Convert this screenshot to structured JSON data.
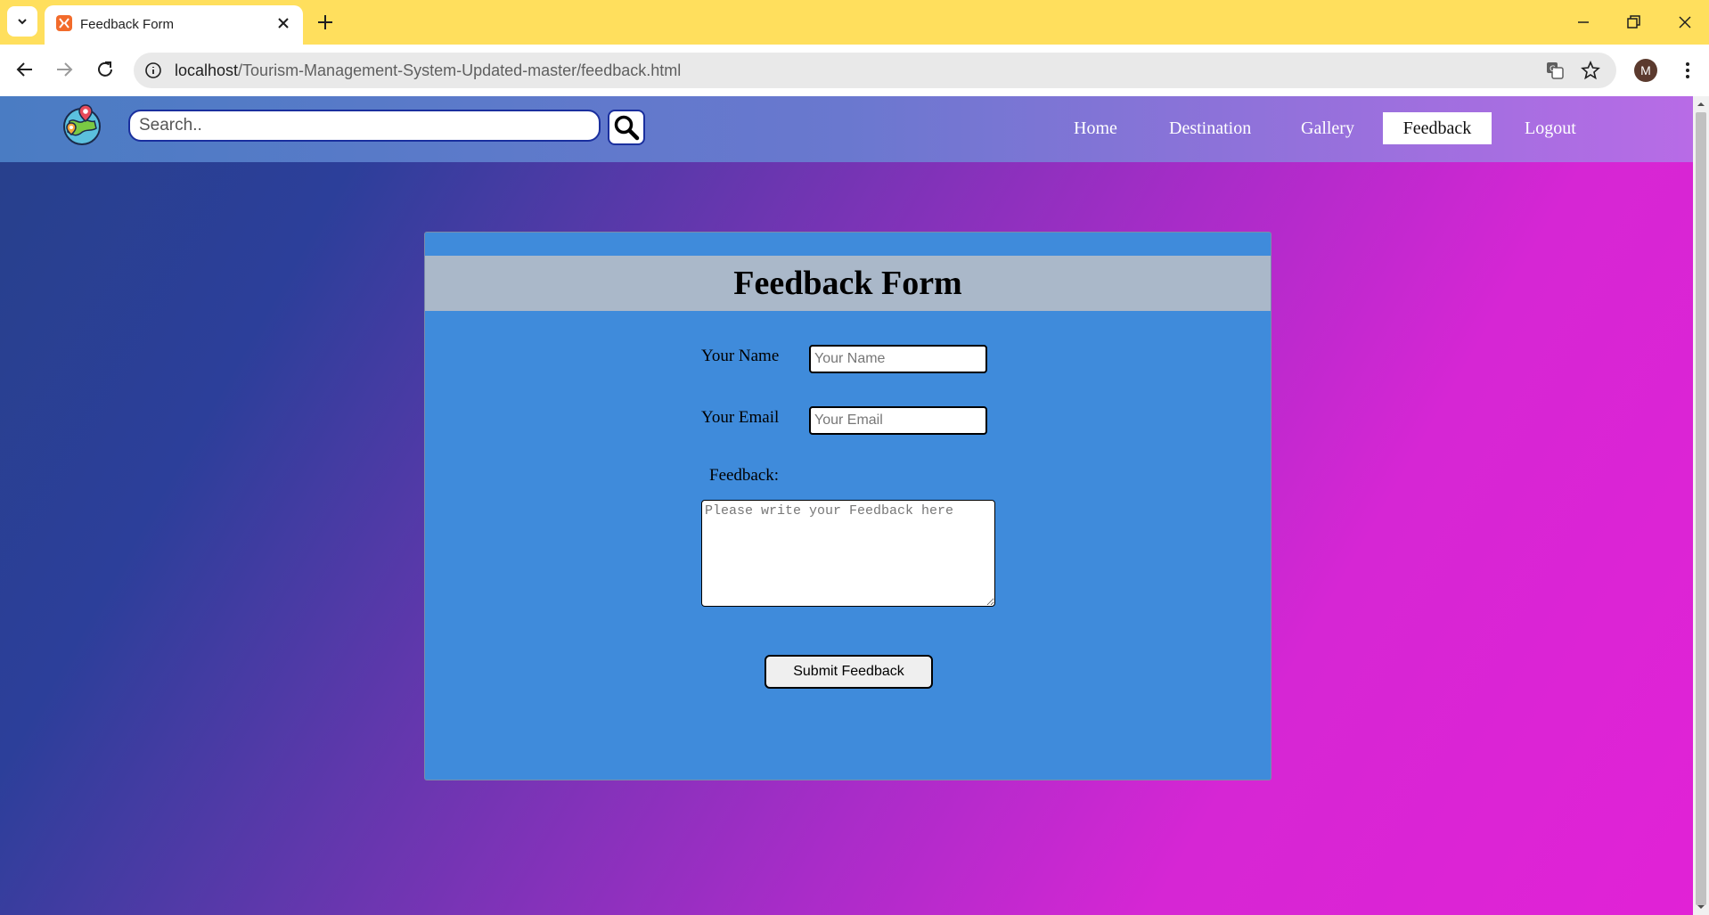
{
  "browser": {
    "tab_title": "Feedback Form",
    "url_host": "localhost",
    "url_path": "/Tourism-Management-System-Updated-master/feedback.html",
    "profile_initial": "M"
  },
  "site": {
    "search_placeholder": "Search..",
    "nav": [
      {
        "label": "Home",
        "active": false
      },
      {
        "label": "Destination",
        "active": false
      },
      {
        "label": "Gallery",
        "active": false
      },
      {
        "label": "Feedback",
        "active": true
      },
      {
        "label": "Logout",
        "active": false
      }
    ]
  },
  "form": {
    "title": "Feedback Form",
    "name_label": "Your Name",
    "name_placeholder": "Your Name",
    "email_label": "Your Email",
    "email_placeholder": "Your Email",
    "feedback_label": "Feedback:",
    "feedback_placeholder": "Please write your Feedback here",
    "submit_label": "Submit Feedback"
  },
  "colors": {
    "tabstrip": "#ffdf5d",
    "card_bg": "#3f8bdb",
    "card_header": "#aab8c9",
    "gradient_start": "#27408b",
    "gradient_end": "#e122d6"
  }
}
